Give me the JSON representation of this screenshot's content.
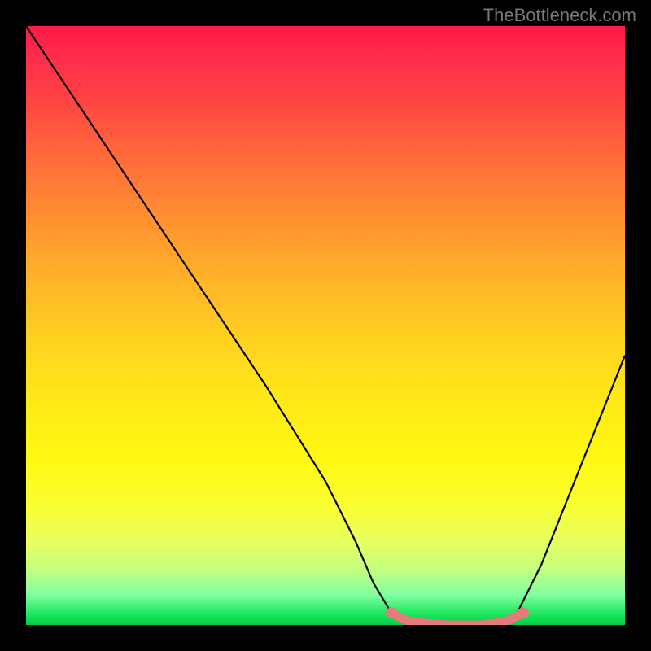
{
  "attribution": "TheBottleneck.com",
  "chart_data": {
    "type": "line",
    "title": "",
    "xlabel": "",
    "ylabel": "",
    "xlim": [
      0,
      100
    ],
    "ylim": [
      0,
      100
    ],
    "curve": [
      {
        "x": 0,
        "y": 100
      },
      {
        "x": 4,
        "y": 94
      },
      {
        "x": 10,
        "y": 85
      },
      {
        "x": 20,
        "y": 70
      },
      {
        "x": 30,
        "y": 55
      },
      {
        "x": 40,
        "y": 40
      },
      {
        "x": 50,
        "y": 24
      },
      {
        "x": 55,
        "y": 14
      },
      {
        "x": 58,
        "y": 7
      },
      {
        "x": 61,
        "y": 2
      },
      {
        "x": 65,
        "y": 0
      },
      {
        "x": 72,
        "y": 0
      },
      {
        "x": 79,
        "y": 0
      },
      {
        "x": 82,
        "y": 2
      },
      {
        "x": 86,
        "y": 10
      },
      {
        "x": 92,
        "y": 25
      },
      {
        "x": 100,
        "y": 45
      }
    ],
    "highlight_segment": {
      "points": [
        {
          "x": 61,
          "y": 2
        },
        {
          "x": 64,
          "y": 0.5
        },
        {
          "x": 70,
          "y": 0
        },
        {
          "x": 76,
          "y": 0
        },
        {
          "x": 80,
          "y": 0.5
        },
        {
          "x": 83,
          "y": 2
        }
      ],
      "color": "#e77a7a"
    },
    "gradient_stops": [
      {
        "pos": 0,
        "color": "#ff1a4a"
      },
      {
        "pos": 50,
        "color": "#ffd020"
      },
      {
        "pos": 85,
        "color": "#faff30"
      },
      {
        "pos": 100,
        "color": "#00d040"
      }
    ]
  }
}
